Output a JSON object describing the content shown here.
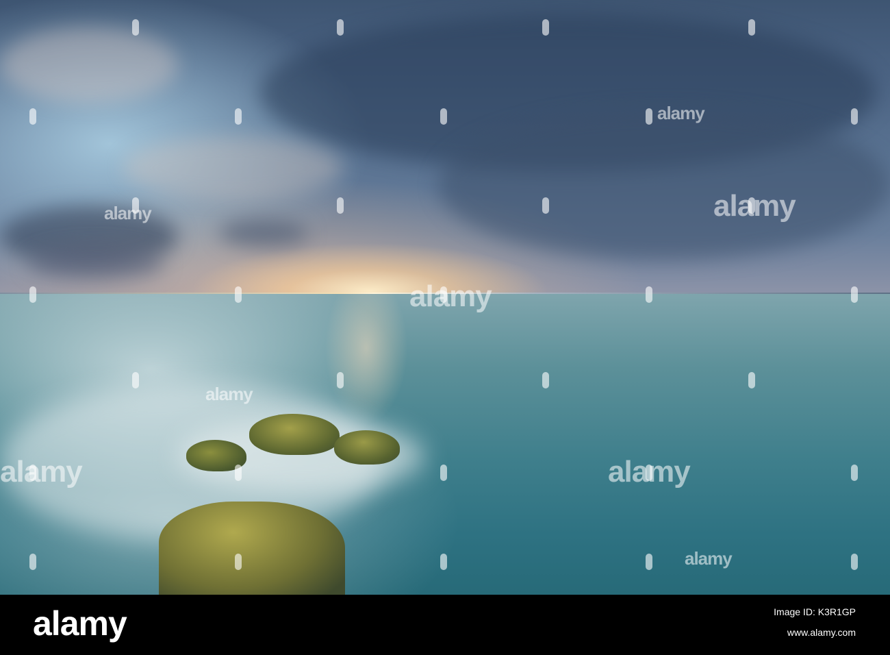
{
  "watermark": {
    "logo_text": "alamy",
    "marks": [
      "alamy",
      "alamy",
      "alamy",
      "alamy",
      "alamy",
      "alamy",
      "alamy",
      "alamy"
    ]
  },
  "footer": {
    "logo": "alamy",
    "image_id": "Image ID: K3R1GP",
    "url": "www.alamy.com"
  }
}
